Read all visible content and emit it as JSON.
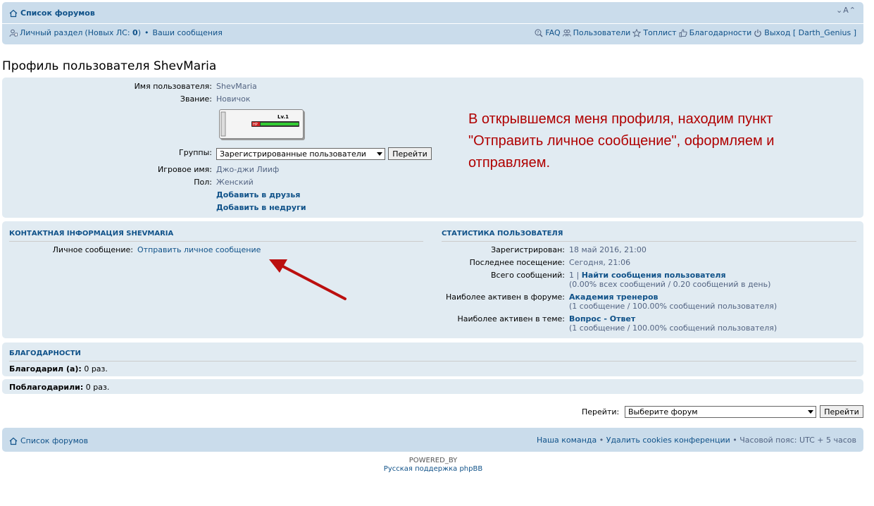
{
  "header": {
    "forum_list": "Список форумов",
    "font_size_ctrl": "⌄A⌃",
    "user_panel": "Личный раздел",
    "new_pm_prefix": "(Новых ЛС: ",
    "new_pm_count": "0",
    "new_pm_suffix": ")",
    "your_posts": "Ваши сообщения",
    "faq": "FAQ",
    "members": "Пользователи",
    "toplist": "Топлист",
    "thanks": "Благодарности",
    "logout": "Выход",
    "username": "Darth_Genius"
  },
  "page_title": "Профиль пользователя ShevMaria",
  "profile": {
    "username_label": "Имя пользователя:",
    "username_value": "ShevMaria",
    "rank_label": "Звание:",
    "rank_value": "Новичок",
    "rank_image_text": "Lv.1",
    "rank_image_hp": "HP",
    "groups_label": "Группы:",
    "groups_selected": "Зарегистрированные пользователи",
    "groups_go": "Перейти",
    "game_name_label": "Игровое имя:",
    "game_name_value": "Джо-джи Лииф",
    "gender_label": "Пол:",
    "gender_value": "Женский",
    "add_friend": "Добавить в друзья",
    "add_foe": "Добавить в недруги"
  },
  "annotation": "В открывшемся меня профиля, находим пункт \"Отправить личное сообщение\", оформляем и отправляем.",
  "contact": {
    "heading": "КОНТАКТНАЯ ІНФОРМАЦИЯ SHEVMARIA",
    "pm_label": "Личное сообщение:",
    "pm_link": "Отправить личное сообщение"
  },
  "stats": {
    "heading": "СТАТИСТИКА ПОЛЬЗОВАТЕЛЯ",
    "registered_label": "Зарегистрирован:",
    "registered_value": "18 май 2016, 21:00",
    "last_visit_label": "Последнее посещение:",
    "last_visit_value": "Сегодня, 21:06",
    "posts_label": "Всего сообщений:",
    "posts_value": "1 |",
    "posts_link": "Найти сообщения пользователя",
    "posts_detail": "(0.00% всех сообщений / 0.20 сообщений в день)",
    "active_forum_label": "Наиболее активен в форуме:",
    "active_forum_value": "Академия тренеров",
    "active_forum_detail": "(1 сообщение / 100.00% сообщений пользователя)",
    "active_topic_label": "Наиболее активен в теме:",
    "active_topic_value": "Вопрос - Ответ",
    "active_topic_detail": "(1 сообщение / 100.00% сообщений пользователя)"
  },
  "thanks": {
    "heading": "БЛАГОДАРНОСТИ",
    "gave_label": "Благодарил (а):",
    "gave_value": "0 раз.",
    "received_label": "Поблагодарили:",
    "received_value": "0 раз."
  },
  "jump": {
    "label": "Перейти:",
    "selected": "Выберите форум",
    "button": "Перейти"
  },
  "footer": {
    "forum_list": "Список форумов",
    "team": "Наша команда",
    "delete_cookies": "Удалить cookies конференции",
    "timezone": "Часовой пояс: UTC + 5 часов",
    "powered_by": "POWERED_BY",
    "support": "Русская поддержка phpBB"
  },
  "colors": {
    "panel_bg": "#e1ebf2",
    "header_bg": "#cadceb",
    "link": "#105289",
    "annotation": "#b00000"
  }
}
